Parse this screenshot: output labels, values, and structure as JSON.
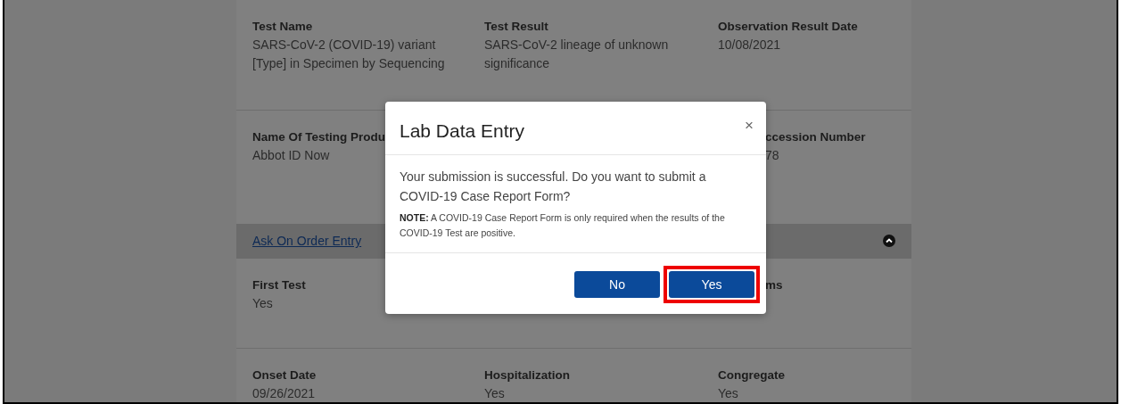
{
  "details": {
    "sections": [
      {
        "kind": "fields",
        "rows": [
          {
            "cells": [
              {
                "label": "Test Name",
                "value": "SARS-CoV-2 (COVID-19) variant [Type] in Specimen by Sequencing"
              },
              {
                "label": "Test Result",
                "value": "SARS-CoV-2 lineage of unknown significance"
              },
              {
                "label": "Observation Result Date",
                "value": "10/08/2021"
              }
            ]
          },
          {
            "cells": [
              {
                "label": "Name Of Testing Produ",
                "value": "Abbot ID Now"
              },
              {},
              {
                "label": "ccession Number",
                "value": "78"
              }
            ]
          }
        ]
      },
      {
        "kind": "accordion",
        "title": "Ask On Order Entry",
        "expanded": true,
        "rows": [
          {
            "cells": [
              {
                "label": "First Test",
                "value": "Yes"
              },
              {},
              {
                "label": "ms"
              }
            ]
          },
          {
            "cells": [
              {
                "label": "Onset Date",
                "value": "09/26/2021"
              },
              {
                "label": "Hospitalization",
                "value": "Yes"
              },
              {
                "label": "Congregate",
                "value": "Yes"
              }
            ]
          }
        ]
      }
    ]
  },
  "modal": {
    "title": "Lab Data Entry",
    "close": "×",
    "message": "Your submission is successful. Do you want to submit a COVID-19 Case Report Form?",
    "note": "**NOTE:** A COVID-19 Case Report Form is only required when the results of the COVID-19 Test are positive.",
    "buttons": [
      {
        "label": "No",
        "highlighted": false
      },
      {
        "label": "Yes",
        "highlighted": true
      }
    ]
  }
}
